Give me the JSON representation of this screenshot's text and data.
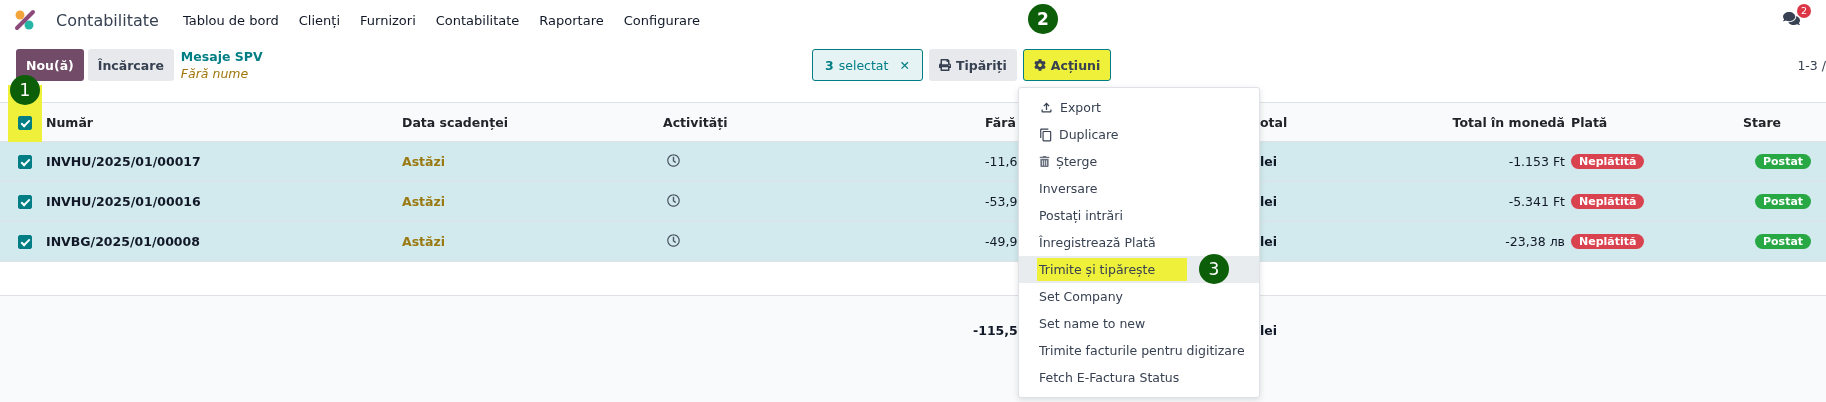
{
  "navbar": {
    "app": "Contabilitate",
    "menu": [
      "Tablou de bord",
      "Clienți",
      "Furnizori",
      "Contabilitate",
      "Raportare",
      "Configurare"
    ],
    "messages_badge": "2"
  },
  "control_panel": {
    "new_button": "Nou(ă)",
    "upload_button": "Încărcare",
    "breadcrumb_link": "Mesaje SPV",
    "breadcrumb_sub": "Fără nume",
    "selection": {
      "count": "3",
      "label": "selectat",
      "clear": "✕"
    },
    "print_button": {
      "label": "Tipăriți"
    },
    "actions_button": {
      "label": "Acțiuni",
      "open": true,
      "annotation": "2"
    },
    "pager": "1-3 /"
  },
  "table": {
    "header_checkbox": {
      "checked": true,
      "annotation": "1"
    },
    "columns": [
      "Număr",
      "Data scadenței",
      "Activități",
      "Fără",
      "otal",
      "Total în monedă",
      "Plată",
      "Stare"
    ],
    "rows": [
      {
        "selected": true,
        "number": "INVHU/2025/01/00017",
        "due": "Astăzi",
        "untaxed": "-11,6",
        "total": "lei",
        "total_currency": "-1.153 Ft",
        "payment": "Neplătită",
        "status": "Postat"
      },
      {
        "selected": true,
        "number": "INVHU/2025/01/00016",
        "due": "Astăzi",
        "untaxed": "-53,9",
        "total": "lei",
        "total_currency": "-5.341 Ft",
        "payment": "Neplătită",
        "status": "Postat"
      },
      {
        "selected": true,
        "number": "INVBG/2025/01/00008",
        "due": "Astăzi",
        "untaxed": "-49,9",
        "total": "lei",
        "total_currency": "-23,38 лв",
        "payment": "Neplătită",
        "status": "Postat"
      }
    ],
    "footer": {
      "untaxed": "-115,5",
      "total": "lei"
    }
  },
  "actions_menu": [
    {
      "kind": "icon",
      "label": "Export",
      "hovered": false
    },
    {
      "kind": "icon",
      "label": "Duplicare",
      "hovered": false
    },
    {
      "kind": "icon",
      "label": "Șterge",
      "hovered": false
    },
    {
      "kind": "plain",
      "label": "Inversare",
      "hovered": false
    },
    {
      "kind": "plain",
      "label": "Postați intrări",
      "hovered": false
    },
    {
      "kind": "plain",
      "label": "Înregistrează Plată",
      "hovered": false
    },
    {
      "kind": "plain",
      "label": "Trimite și tipărește",
      "hovered": true,
      "annotation": "3"
    },
    {
      "kind": "plain",
      "label": "Set Company",
      "hovered": false
    },
    {
      "kind": "plain",
      "label": "Set name to new",
      "hovered": false
    },
    {
      "kind": "plain",
      "label": "Trimite facturile pentru digitizare",
      "hovered": false
    },
    {
      "kind": "plain",
      "label": "Fetch E-Factura Status",
      "hovered": false
    }
  ]
}
